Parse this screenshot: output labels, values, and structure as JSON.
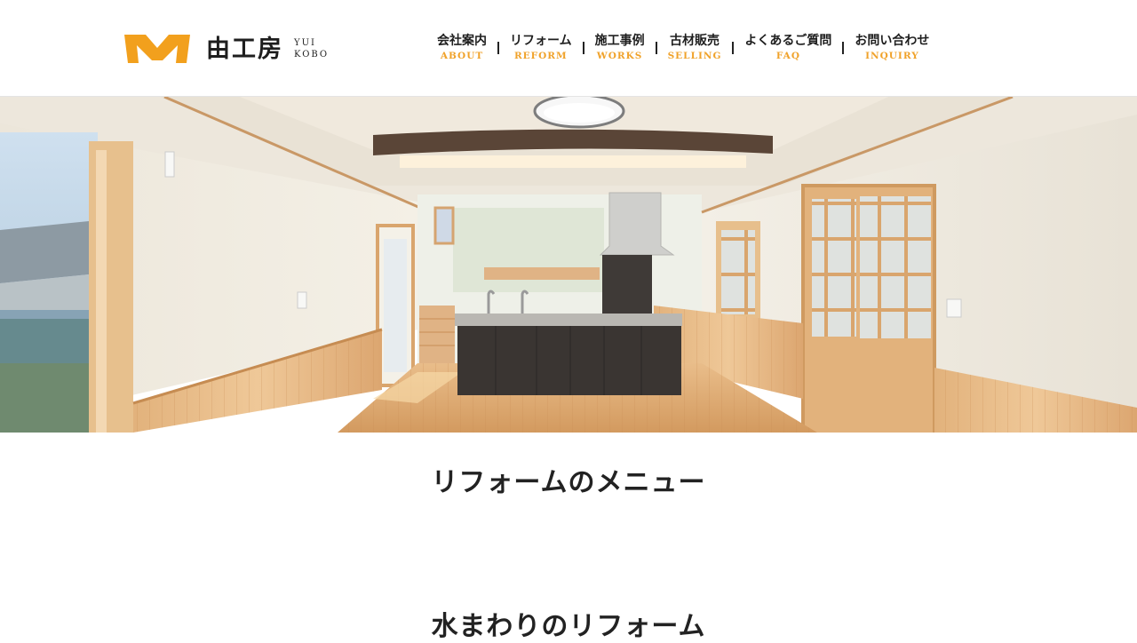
{
  "brand": {
    "name_jp": "由工房",
    "name_en_line1": "YUI",
    "name_en_line2": "KOBO",
    "accent_color": "#f2a01d"
  },
  "nav": {
    "items": [
      {
        "jp": "会社案内",
        "en": "ABOUT"
      },
      {
        "jp": "リフォーム",
        "en": "REFORM"
      },
      {
        "jp": "施工事例",
        "en": "WORKS"
      },
      {
        "jp": "古材販売",
        "en": "SELLING"
      },
      {
        "jp": "よくあるご質問",
        "en": "FAQ"
      },
      {
        "jp": "お問い合わせ",
        "en": "INQUIRY"
      }
    ]
  },
  "hero": {
    "icon": "interior-photo"
  },
  "sections": {
    "menu_title": "リフォームのメニュー",
    "water_title": "水まわりのリフォーム"
  }
}
